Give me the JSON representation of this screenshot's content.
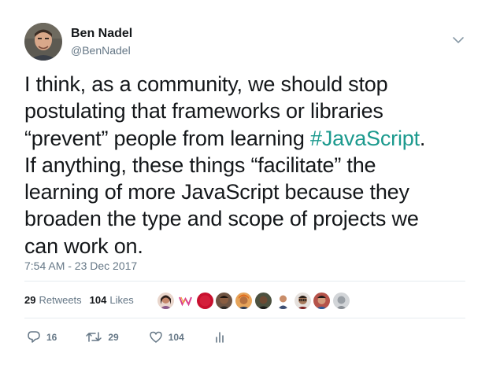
{
  "author": {
    "name": "Ben Nadel",
    "handle": "@BenNadel"
  },
  "tweet": {
    "lines": [
      "I think, as a community, we should stop",
      "postulating that frameworks or libraries",
      "“prevent” people from learning ",
      "If anything, these things “facilitate” the",
      "learning of more JavaScript because they",
      "broaden the type and scope of projects we",
      "can work on."
    ],
    "hashtag": "#JavaScript",
    "after_hashtag": ".",
    "timestamp": "7:54 AM - 23 Dec 2017"
  },
  "stats": {
    "retweets_count": "29",
    "retweets_label": "Retweets",
    "likes_count": "104",
    "likes_label": "Likes"
  },
  "likers": [
    {
      "icon": "avatar-woman",
      "color": "#d98a8a"
    },
    {
      "icon": "logo-w",
      "color": "#ffffff"
    },
    {
      "icon": "avatar-red",
      "color": "#cc1f3a"
    },
    {
      "icon": "avatar-man",
      "color": "#5a3b2a"
    },
    {
      "icon": "avatar-orange",
      "color": "#d9812b"
    },
    {
      "icon": "avatar-dark",
      "color": "#3a3d33"
    },
    {
      "icon": "avatar-bald",
      "color": "#c98d69"
    },
    {
      "icon": "avatar-glasses",
      "color": "#8b6b55"
    },
    {
      "icon": "avatar-photo",
      "color": "#a8554c"
    },
    {
      "icon": "avatar-gray",
      "color": "#b8bcc0"
    }
  ],
  "actions": {
    "replies": "16",
    "retweets": "29",
    "likes": "104"
  },
  "colors": {
    "text": "#14171a",
    "secondary": "#657786",
    "hashtag": "#1c9a8e",
    "divider": "#e6ecf0"
  }
}
